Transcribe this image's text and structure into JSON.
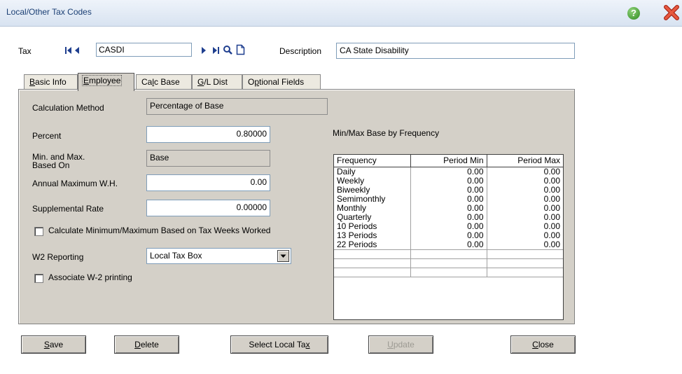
{
  "window": {
    "title": "Local/Other Tax Codes"
  },
  "header": {
    "tax_label": "Tax",
    "tax_value": "CASDI",
    "description_label": "Description",
    "description_value": "CA State Disability"
  },
  "tabs": [
    {
      "pre": "",
      "key": "B",
      "post": "asic Info",
      "active": false
    },
    {
      "pre": "",
      "key": "E",
      "post": "mployee",
      "active": true
    },
    {
      "pre": "Ca",
      "key": "l",
      "post": "c Base",
      "active": false
    },
    {
      "pre": "",
      "key": "G",
      "post": "/L Dist",
      "active": false
    },
    {
      "pre": "O",
      "key": "p",
      "post": "tional Fields",
      "active": false
    }
  ],
  "form": {
    "calc_method_label": "Calculation Method",
    "calc_method_value": "Percentage of Base",
    "percent_label": "Percent",
    "percent_value": "0.80000",
    "minmax_label_1": "Min. and Max.",
    "minmax_label_2": "Based On",
    "minmax_value": "Base",
    "annual_max_label": "Annual Maximum W.H.",
    "annual_max_value": "0.00",
    "supp_rate_label": "Supplemental Rate",
    "supp_rate_value": "0.00000",
    "calc_tax_weeks_label": "Calculate Minimum/Maximum Based on Tax Weeks Worked",
    "w2_label": "W2 Reporting",
    "w2_value": "Local Tax Box",
    "assoc_w2_label": "Associate W-2 printing"
  },
  "grid": {
    "caption": "Min/Max Base by Frequency",
    "columns": [
      "Frequency",
      "Period Min",
      "Period Max"
    ],
    "rows": [
      [
        "Daily",
        "0.00",
        "0.00"
      ],
      [
        "Weekly",
        "0.00",
        "0.00"
      ],
      [
        "Biweekly",
        "0.00",
        "0.00"
      ],
      [
        "Semimonthly",
        "0.00",
        "0.00"
      ],
      [
        "Monthly",
        "0.00",
        "0.00"
      ],
      [
        "Quarterly",
        "0.00",
        "0.00"
      ],
      [
        "10 Periods",
        "0.00",
        "0.00"
      ],
      [
        "13 Periods",
        "0.00",
        "0.00"
      ],
      [
        "22 Periods",
        "0.00",
        "0.00"
      ]
    ]
  },
  "buttons": {
    "save": {
      "key": "S",
      "rest": "ave"
    },
    "delete": {
      "key": "D",
      "rest": "elete"
    },
    "select": {
      "pre": "Select Local Ta",
      "key": "x"
    },
    "update": {
      "key": "U",
      "rest": "pdate"
    },
    "close": {
      "key": "C",
      "rest": "lose"
    }
  },
  "colors": {
    "panel": "#d4d0c8",
    "title_text": "#1b3f74",
    "help": "#2f8a1f",
    "close": "#d9422b"
  }
}
